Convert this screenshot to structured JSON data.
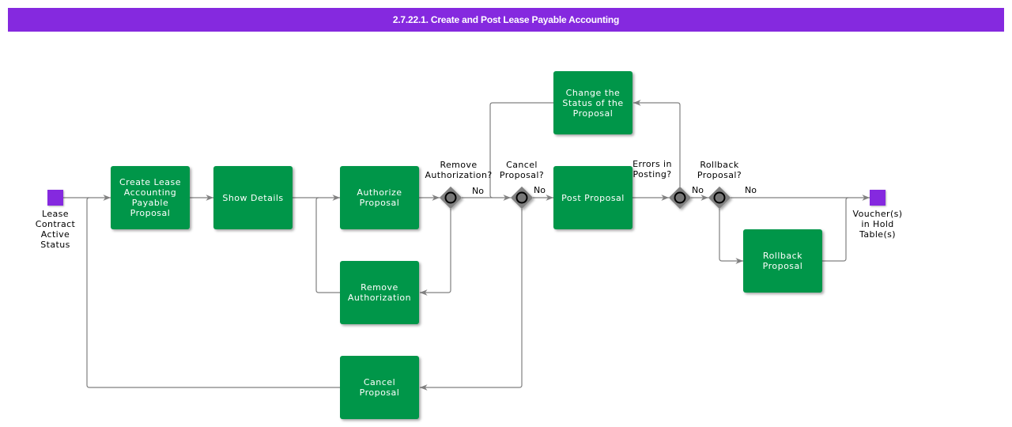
{
  "header": {
    "title": "2.7.22.1. Create and Post Lease Payable Accounting"
  },
  "colors": {
    "title_bar": "#8529df",
    "task": "#009649",
    "event": "#8529df",
    "gateway": "#808080",
    "connector": "#808080"
  },
  "events": {
    "start": {
      "label": "Lease\nContract\nActive\nStatus"
    },
    "end": {
      "label": "Voucher(s)\nin Hold\nTable(s)"
    }
  },
  "tasks": {
    "create_proposal": "Create Lease\nAccounting\nPayable\nProposal",
    "show_details": "Show Details",
    "authorize_proposal": "Authorize\nProposal",
    "remove_authorization": "Remove\nAuthorization",
    "cancel_proposal": "Cancel Proposal",
    "change_status": "Change the\nStatus of the\nProposal",
    "post_proposal": "Post Proposal",
    "rollback_proposal": "Rollback\nProposal"
  },
  "gateways": {
    "remove_authorization": "Remove\nAuthorization?",
    "cancel_proposal": "Cancel\nProposal?",
    "errors_in_posting": "Errors in\nPosting?",
    "rollback_proposal": "Rollback\nProposal?"
  },
  "flow_labels": {
    "remove_auth_no": "No",
    "cancel_no": "No",
    "errors_no": "No",
    "rollback_no": "No"
  }
}
